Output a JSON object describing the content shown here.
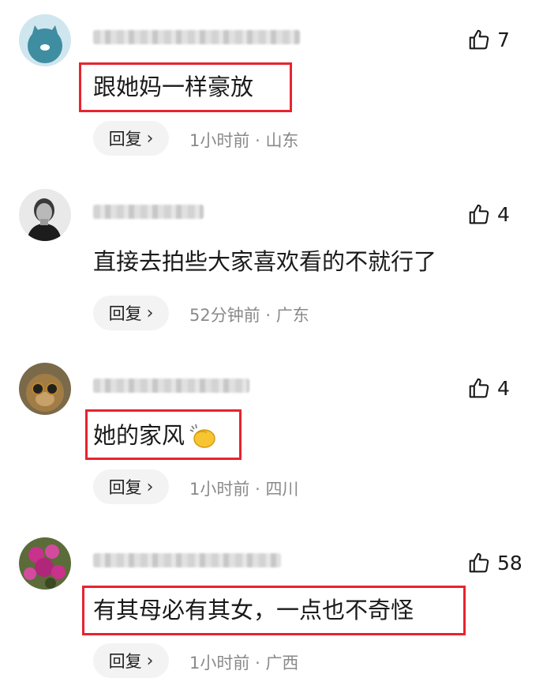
{
  "comments": [
    {
      "avatar": "blue-cat-default-avatar",
      "likes": "7",
      "text": "跟她妈一样豪放",
      "reply_label": "回复",
      "time": "1小时前",
      "separator": "·",
      "location": "山东",
      "highlighted": true
    },
    {
      "avatar": "man-portrait-avatar",
      "likes": "4",
      "text": "直接去拍些大家喜欢看的不就行了",
      "reply_label": "回复",
      "time": "52分钟前",
      "separator": "·",
      "location": "广东",
      "highlighted": false
    },
    {
      "avatar": "dog-sunglasses-avatar",
      "likes": "4",
      "text": "她的家风",
      "emoji": "clapping-hands-emoji",
      "reply_label": "回复",
      "time": "1小时前",
      "separator": "·",
      "location": "四川",
      "highlighted": true
    },
    {
      "avatar": "pink-flowers-avatar",
      "likes": "58",
      "text": "有其母必有其女，一点也不奇怪",
      "reply_label": "回复",
      "time": "1小时前",
      "separator": "·",
      "location": "广西",
      "highlighted": true
    }
  ],
  "colors": {
    "highlight": "#e8232f",
    "meta_text": "#8a8a8a",
    "reply_bg": "#f3f3f3"
  },
  "icons": {
    "like": "thumbs-up-icon",
    "reply_arrow": "chevron-right-icon"
  }
}
